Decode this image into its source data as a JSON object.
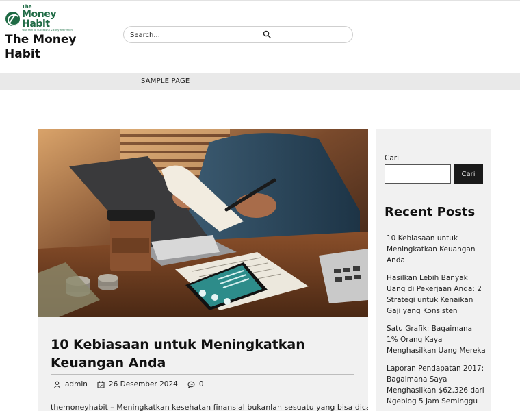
{
  "header": {
    "logo": {
      "small_text": "The",
      "big_text": "Money Habit",
      "tagline": "Your Path To Successful & Early Retirement",
      "icon": "leaf-globe-logo-icon"
    },
    "site_title": "The Money Habit",
    "search": {
      "placeholder": "Search...",
      "icon": "search-icon"
    }
  },
  "nav": {
    "items": [
      {
        "label": "SAMPLE PAGE"
      }
    ]
  },
  "post": {
    "image_alt": "Person reviewing receipts with calculator, smartphone budgeting app and coffee cup on a desk",
    "title": "10 Kebiasaan untuk Meningkatkan Keuangan Anda",
    "meta": {
      "author": "admin",
      "date": "26 Desember 2024",
      "comments": "0"
    },
    "excerpt": "themoneyhabit – Meningkatkan kesehatan finansial bukanlah sesuatu yang bisa dicapai"
  },
  "sidebar": {
    "search_label": "Cari",
    "search_button": "Cari",
    "recent_heading": "Recent Posts",
    "recent_posts": [
      "10 Kebiasaan untuk Meningkatkan Keuangan Anda",
      "Hasilkan Lebih Banyak Uang di Pekerjaan Anda: 2 Strategi untuk Kenaikan Gaji yang Konsisten",
      "Satu Grafik: Bagaimana 1% Orang Kaya Menghasilkan Uang Mereka",
      "Laporan Pendapatan 2017: Bagaimana Saya Menghasilkan $62.326 dari Ngeblog 5 Jam Seminggu"
    ]
  },
  "colors": {
    "brand_green": "#1f6b45",
    "nav_bg": "#e9e9e9",
    "card_bg": "#f1f1f1",
    "button_bg": "#1a1a1a"
  }
}
